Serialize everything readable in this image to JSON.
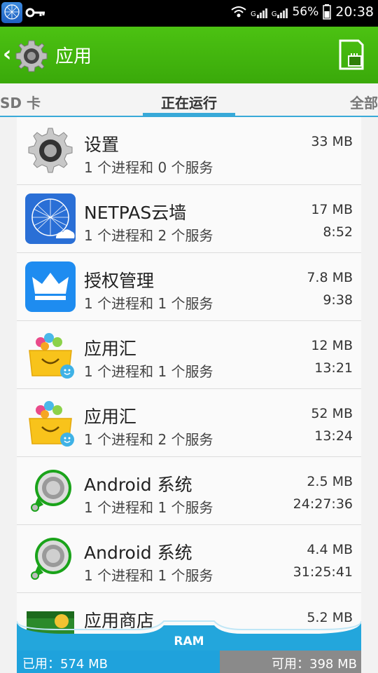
{
  "status_bar": {
    "signal1": "G",
    "signal2": "G",
    "battery": "56%",
    "clock": "20:38"
  },
  "action_bar": {
    "title": "应用"
  },
  "tabs": [
    {
      "label": "SD 卡"
    },
    {
      "label": "正在运行"
    },
    {
      "label": "全部"
    }
  ],
  "apps": [
    {
      "name": "设置",
      "sub": "1 个进程和 0 个服务",
      "size": "33 MB",
      "time": "",
      "icon": "settings-gear-icon"
    },
    {
      "name": "NETPAS云墙",
      "sub": "1 个进程和 2 个服务",
      "size": "17 MB",
      "time": "8:52",
      "icon": "netpas-globe-icon"
    },
    {
      "name": "授权管理",
      "sub": "1 个进程和 1 个服务",
      "size": "7.8 MB",
      "time": "9:38",
      "icon": "crown-icon"
    },
    {
      "name": "应用汇",
      "sub": "1 个进程和 1 个服务",
      "size": "12 MB",
      "time": "13:21",
      "icon": "appchina-bag-icon"
    },
    {
      "name": "应用汇",
      "sub": "1 个进程和 2 个服务",
      "size": "52 MB",
      "time": "13:24",
      "icon": "appchina-bag-icon"
    },
    {
      "name": "Android 系统",
      "sub": "1 个进程和 1 个服务",
      "size": "2.5 MB",
      "time": "24:27:36",
      "icon": "android-system-icon"
    },
    {
      "name": "Android 系统",
      "sub": "1 个进程和 1 个服务",
      "size": "4.4 MB",
      "time": "31:25:41",
      "icon": "android-system-icon"
    },
    {
      "name": "应用商店",
      "sub": "",
      "size": "5.2 MB",
      "time": "",
      "icon": "app-store-icon"
    }
  ],
  "ram": {
    "label": "RAM",
    "used_text": "已用：574 MB",
    "free_text": "可用：398 MB",
    "used_fraction": 0.59
  },
  "colors": {
    "action_bar": "#3aa90a",
    "accent": "#38a9d8",
    "ram_used": "#1fa2dc"
  }
}
